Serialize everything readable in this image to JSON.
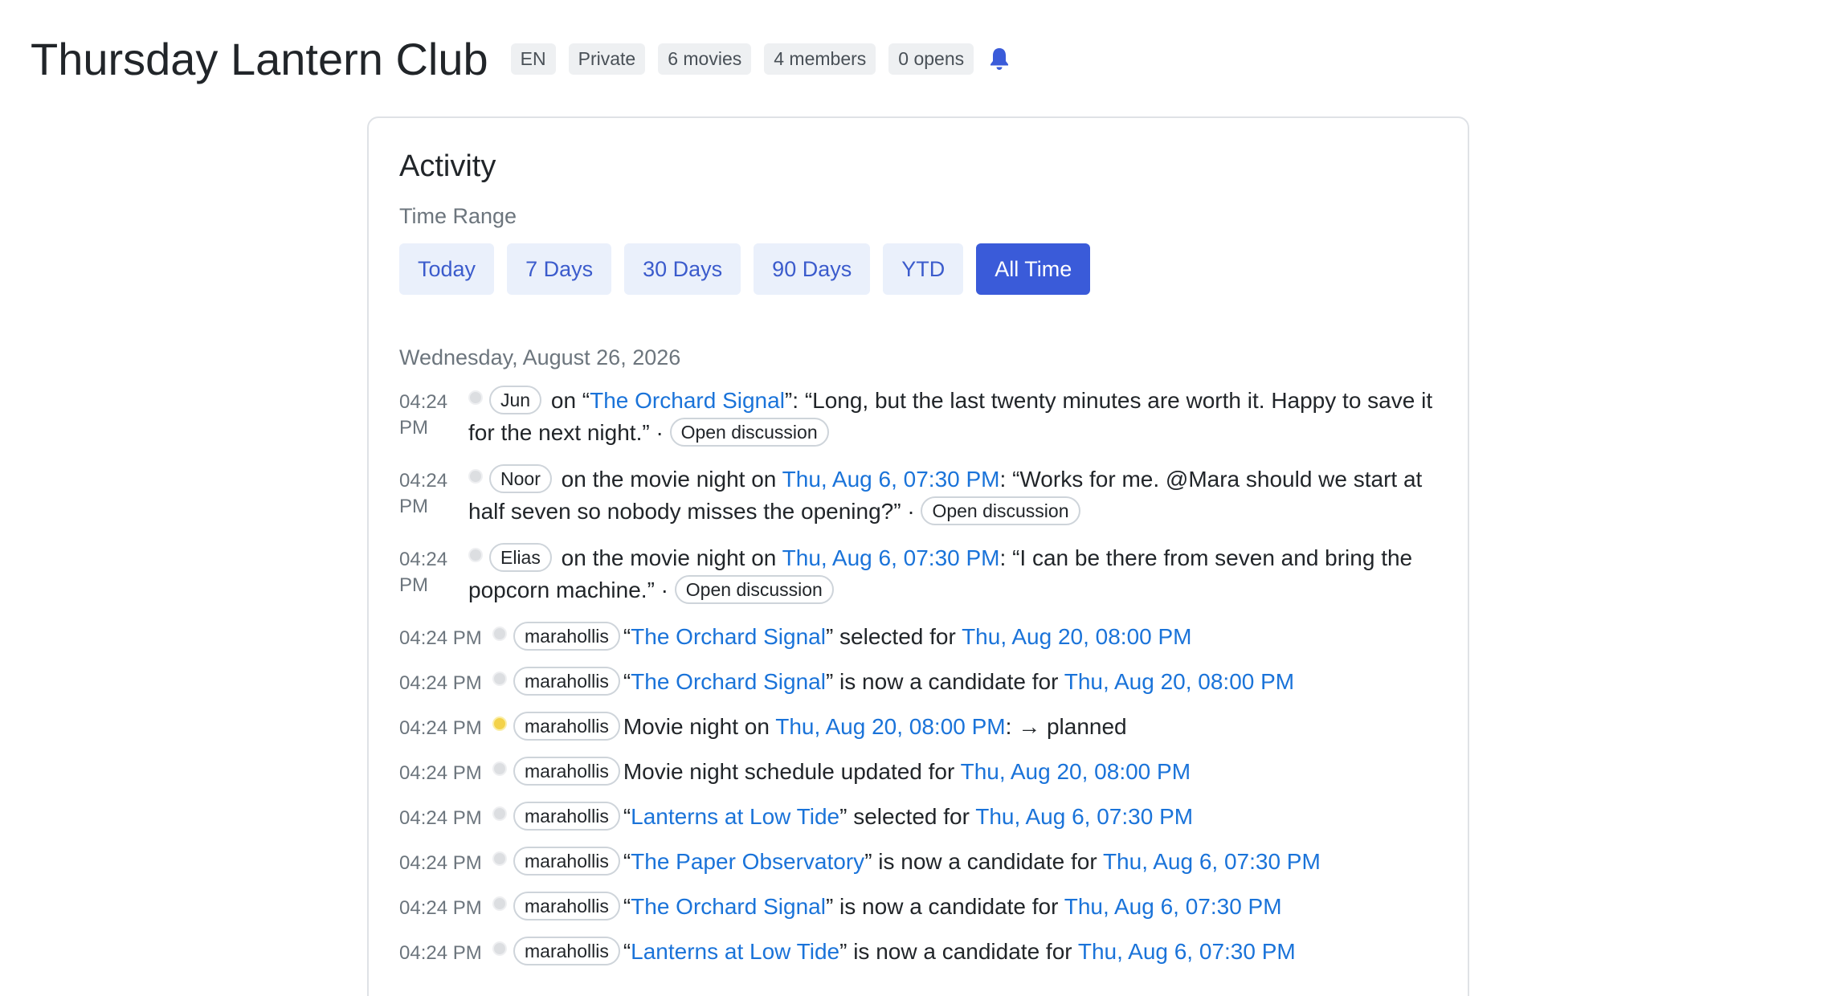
{
  "club": {
    "title": "Thursday Lantern Club",
    "language": "EN",
    "visibility": "Private",
    "movies": "6 movies",
    "members": "4 members",
    "opens": "0 opens",
    "bell_icon": "bell-icon",
    "accent_color": "#3a5bd9"
  },
  "activity": {
    "title": "Activity",
    "range_label": "Time Range",
    "ranges": [
      {
        "label": "Today",
        "active": false
      },
      {
        "label": "7 Days",
        "active": false
      },
      {
        "label": "30 Days",
        "active": false
      },
      {
        "label": "90 Days",
        "active": false
      },
      {
        "label": "YTD",
        "active": false
      },
      {
        "label": "All Time",
        "active": true
      }
    ],
    "day_heading": "Wednesday, August 26, 2026",
    "comments": [
      {
        "time_hm": "04:24",
        "time_ampm": "PM",
        "user": "Jun",
        "prefix": " on “",
        "target": "The Orchard Signal",
        "mid": "”: ",
        "quote": "“Long, but the last twenty minutes are worth it. Happy to save it for the next night.”",
        "sep": " · ",
        "action": "Open discussion"
      },
      {
        "time_hm": "04:24",
        "time_ampm": "PM",
        "user": "Noor",
        "prefix": " on the movie night on ",
        "target": "Thu, Aug 6, 07:30 PM",
        "mid": ": ",
        "quote": "“Works for me. @Mara should we start at half seven so nobody misses the opening?”",
        "sep": " · ",
        "action": "Open discussion"
      },
      {
        "time_hm": "04:24",
        "time_ampm": "PM",
        "user": "Elias",
        "prefix": " on the movie night on ",
        "target": "Thu, Aug 6, 07:30 PM",
        "mid": ": ",
        "quote": "“I can be there from seven and bring the popcorn machine.”",
        "sep": " · ",
        "action": "Open discussion"
      }
    ],
    "events": [
      {
        "time": "04:24 PM",
        "dot": "gray",
        "user": "marahollis",
        "t1": "“",
        "l1": "The Orchard Signal",
        "t2": "” selected for ",
        "l2": "Thu, Aug 20, 08:00 PM",
        "t3": ""
      },
      {
        "time": "04:24 PM",
        "dot": "gray",
        "user": "marahollis",
        "t1": "“",
        "l1": "The Orchard Signal",
        "t2": "” is now a candidate for ",
        "l2": "Thu, Aug 20, 08:00 PM",
        "t3": ""
      },
      {
        "time": "04:24 PM",
        "dot": "yellow",
        "user": "marahollis",
        "t1": "Movie night on ",
        "l1": "Thu, Aug 20, 08:00 PM",
        "t2": ": → planned",
        "l2": "",
        "t3": ""
      },
      {
        "time": "04:24 PM",
        "dot": "gray",
        "user": "marahollis",
        "t1": "Movie night schedule updated for ",
        "l1": "Thu, Aug 20, 08:00 PM",
        "t2": "",
        "l2": "",
        "t3": ""
      },
      {
        "time": "04:24 PM",
        "dot": "gray",
        "user": "marahollis",
        "t1": "“",
        "l1": "Lanterns at Low Tide",
        "t2": "” selected for ",
        "l2": "Thu, Aug 6, 07:30 PM",
        "t3": ""
      },
      {
        "time": "04:24 PM",
        "dot": "gray",
        "user": "marahollis",
        "t1": "“",
        "l1": "The Paper Observatory",
        "t2": "” is now a candidate for ",
        "l2": "Thu, Aug 6, 07:30 PM",
        "t3": ""
      },
      {
        "time": "04:24 PM",
        "dot": "gray",
        "user": "marahollis",
        "t1": "“",
        "l1": "The Orchard Signal",
        "t2": "” is now a candidate for ",
        "l2": "Thu, Aug 6, 07:30 PM",
        "t3": ""
      },
      {
        "time": "04:24 PM",
        "dot": "gray",
        "user": "marahollis",
        "t1": "“",
        "l1": "Lanterns at Low Tide",
        "t2": "” is now a candidate for ",
        "l2": "Thu, Aug 6, 07:30 PM",
        "t3": ""
      }
    ],
    "dot_colors": {
      "gray": "#dcdee1",
      "yellow": "#f3d24a"
    },
    "link_color": "#1a73d9"
  }
}
